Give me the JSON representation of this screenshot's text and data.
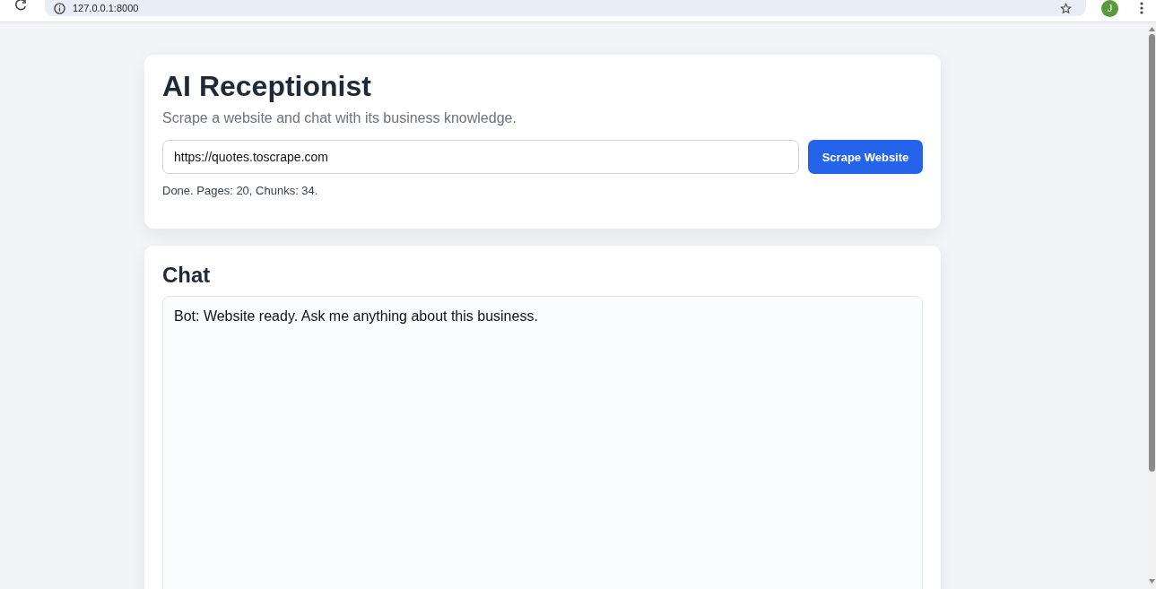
{
  "browser": {
    "address": "127.0.0.1:8000",
    "avatar_initial": "J"
  },
  "setup_card": {
    "title": "AI Receptionist",
    "subtitle": "Scrape a website and chat with its business knowledge.",
    "url_field": {
      "value": "https://quotes.toscrape.com"
    },
    "button": "Scrape Website",
    "status": "Done. Pages: 20, Chunks: 34."
  },
  "chat_card": {
    "title": "Chat",
    "messages": [
      {
        "text": "Bot: Website ready. Ask me anything about this business."
      }
    ]
  }
}
